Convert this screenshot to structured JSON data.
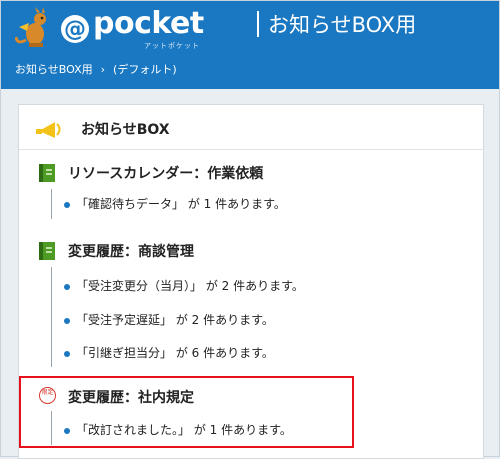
{
  "header": {
    "logo_word": "pocket",
    "logo_tagline": "アットポケット",
    "app_title": "お知らせBOX用",
    "brand_color": "#1a78c2"
  },
  "breadcrumb": {
    "root": "お知らせBOX用",
    "separator": "›",
    "current": "(デフォルト)"
  },
  "panel": {
    "title": "お知らせBOX",
    "sections": [
      {
        "title": "リソースカレンダー：作業依頼",
        "icon": "green-book-icon",
        "items": [
          "「確認待ちデータ」 が 1 件あります。"
        ]
      },
      {
        "title": "変更履歴：商談管理",
        "icon": "green-book-icon",
        "items": [
          "「受注変更分（当月）」 が 2 件あります。",
          "「受注予定遅延」 が 2 件あります。",
          "「引継ぎ担当分」 が 6 件あります。"
        ]
      },
      {
        "title": "変更履歴：社内規定",
        "icon": "limited-badge-icon",
        "badge_text": "限定",
        "items": [
          "「改訂されました。」 が 1 件あります。"
        ]
      }
    ]
  },
  "colors": {
    "highlight": "#e8101a",
    "bullet": "#1a78c2"
  }
}
